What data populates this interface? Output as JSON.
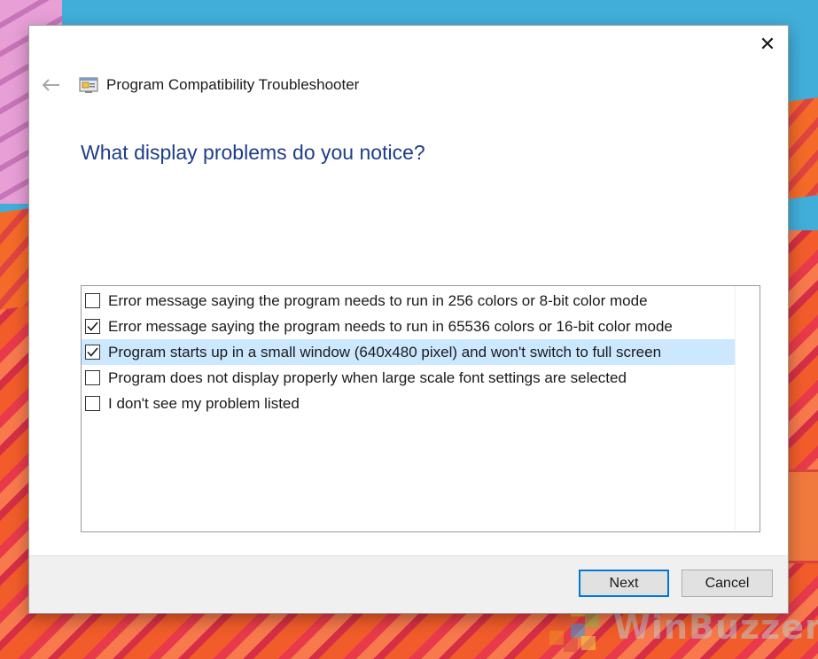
{
  "window": {
    "title": "Program Compatibility Troubleshooter",
    "close_glyph": "✕",
    "back_icon": "back-arrow-icon",
    "app_icon": "troubleshooter-app-icon"
  },
  "page": {
    "question": "What display problems do you notice?"
  },
  "options": [
    {
      "label": "Error message saying the program needs to run in 256 colors or 8-bit color mode",
      "checked": false,
      "selected": false
    },
    {
      "label": "Error message saying the program needs to run in 65536 colors or 16-bit color mode",
      "checked": true,
      "selected": false
    },
    {
      "label": "Program starts up in a small window (640x480 pixel) and won't switch to full screen",
      "checked": true,
      "selected": true
    },
    {
      "label": "Program does not display properly when large scale font settings are selected",
      "checked": false,
      "selected": false
    },
    {
      "label": "I don't see my problem listed",
      "checked": false,
      "selected": false
    }
  ],
  "buttons": {
    "next": "Next",
    "cancel": "Cancel"
  },
  "watermark": {
    "text": "WinBuzzer"
  },
  "colors": {
    "heading": "#1e3d8a",
    "selection": "#cce8ff",
    "primary_border": "#0078d7"
  }
}
